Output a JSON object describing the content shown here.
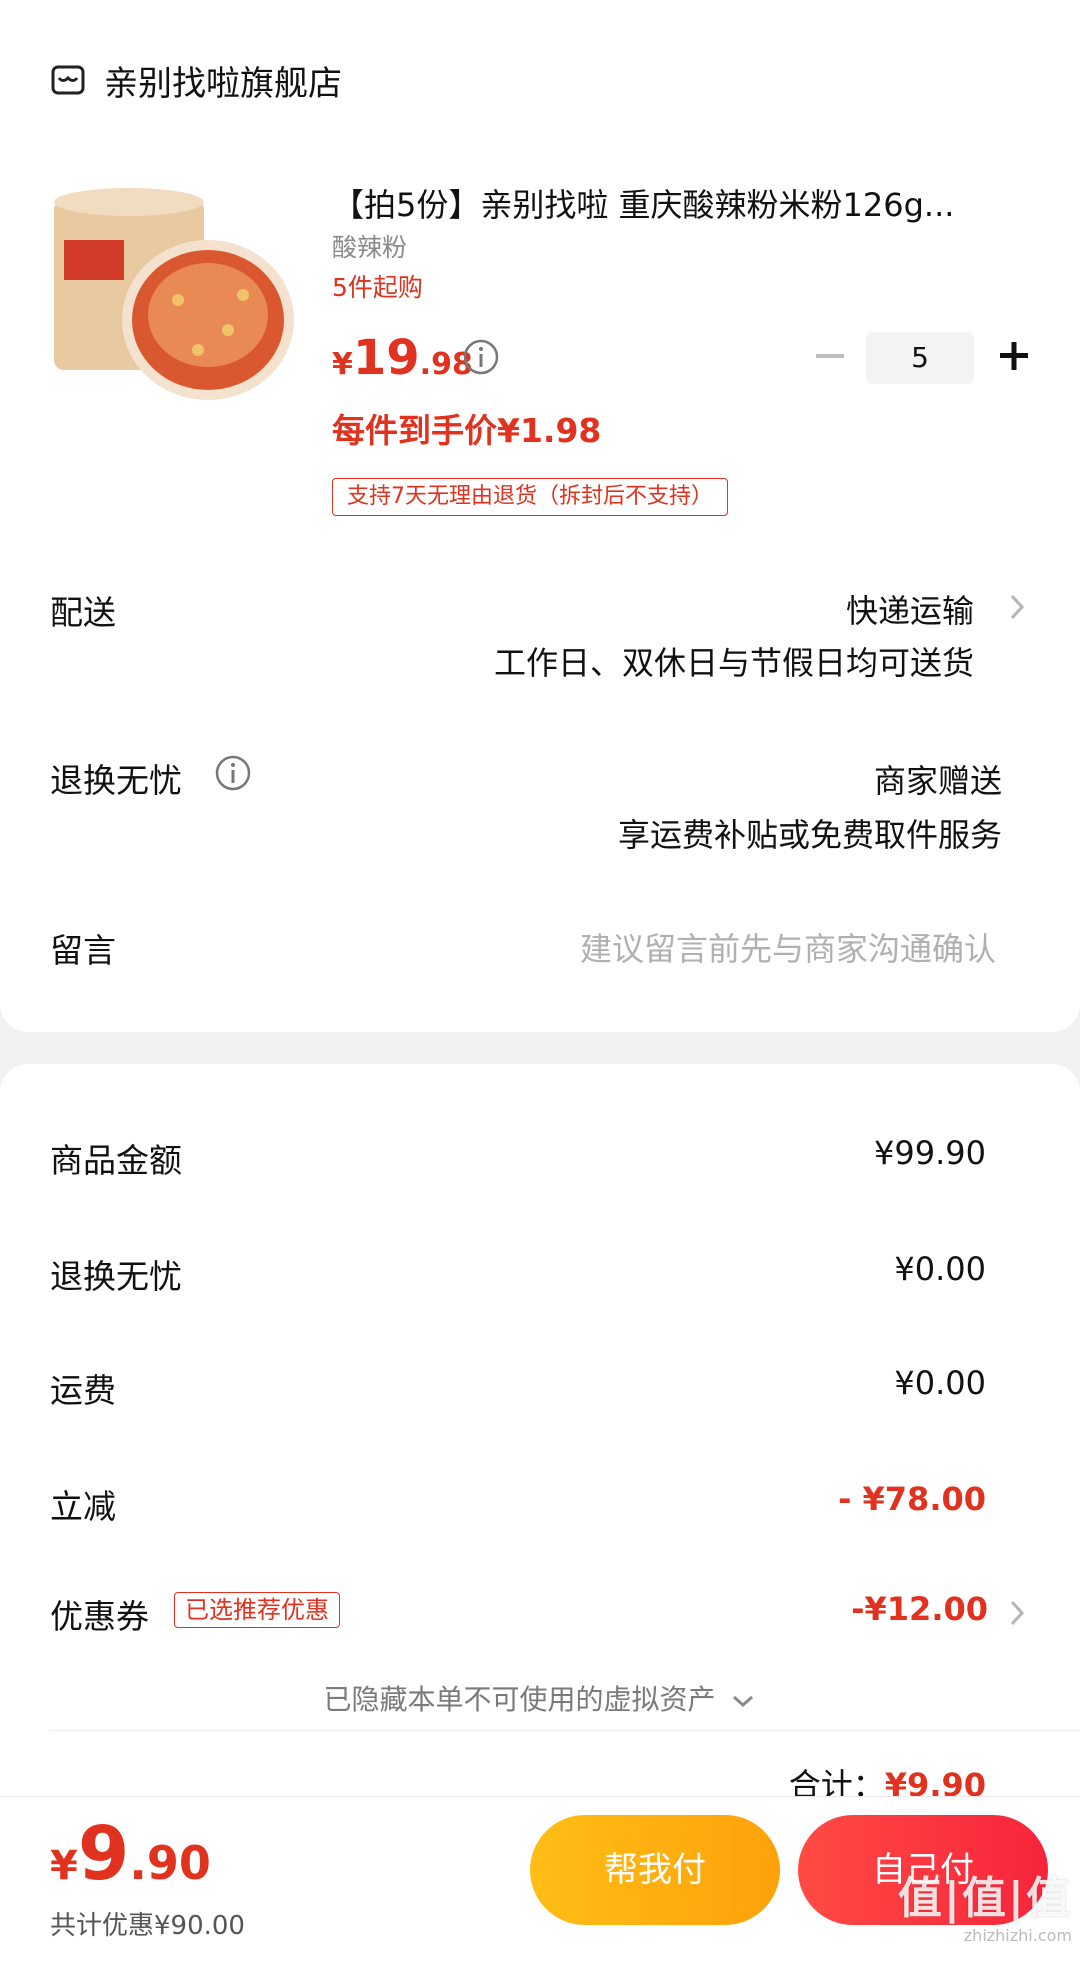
{
  "store": {
    "name": "亲别找啦旗舰店",
    "icon": "store-icon"
  },
  "product": {
    "title": "【拍5份】亲别找啦 重庆酸辣粉米粉126g...",
    "spec": "酸辣粉",
    "min_purchase": "5件起购",
    "price_symbol": "¥",
    "price_int": "19",
    "price_dec": ".98",
    "unit_price": "每件到手价¥1.98",
    "return_tag": "支持7天无理由退货（拆封后不支持）",
    "quantity": "5"
  },
  "delivery": {
    "label": "配送",
    "method": "快递运输",
    "note": "工作日、双休日与节假日均可送货"
  },
  "return_service": {
    "label": "退换无忧",
    "value": "商家赠送",
    "note": "享运费补贴或免费取件服务"
  },
  "message": {
    "label": "留言",
    "placeholder": "建议留言前先与商家沟通确认"
  },
  "summary": {
    "rows": [
      {
        "label": "商品金额",
        "value": "¥99.90"
      },
      {
        "label": "退换无忧",
        "value": "¥0.00"
      },
      {
        "label": "运费",
        "value": "¥0.00"
      },
      {
        "label": "立减",
        "value": "- ¥78.00"
      },
      {
        "label": "优惠券",
        "value": "-¥12.00"
      }
    ],
    "coupon_tag": "已选推荐优惠",
    "hidden_assets": "已隐藏本单不可使用的虚拟资产",
    "total_label": "合计：",
    "total_value": "¥9.90"
  },
  "bottom": {
    "price_symbol": "¥",
    "price_int": "9",
    "price_dec": ".90",
    "saving": "共计优惠¥90.00",
    "btn_help": "帮我付",
    "btn_self": "自己付"
  },
  "watermark": {
    "big": "值|值|值",
    "small": "zhizhizhi.com"
  },
  "colors": {
    "accent_red": "#e0321e",
    "btn_yellow": "#ffb20f",
    "btn_red": "#f7243c"
  }
}
